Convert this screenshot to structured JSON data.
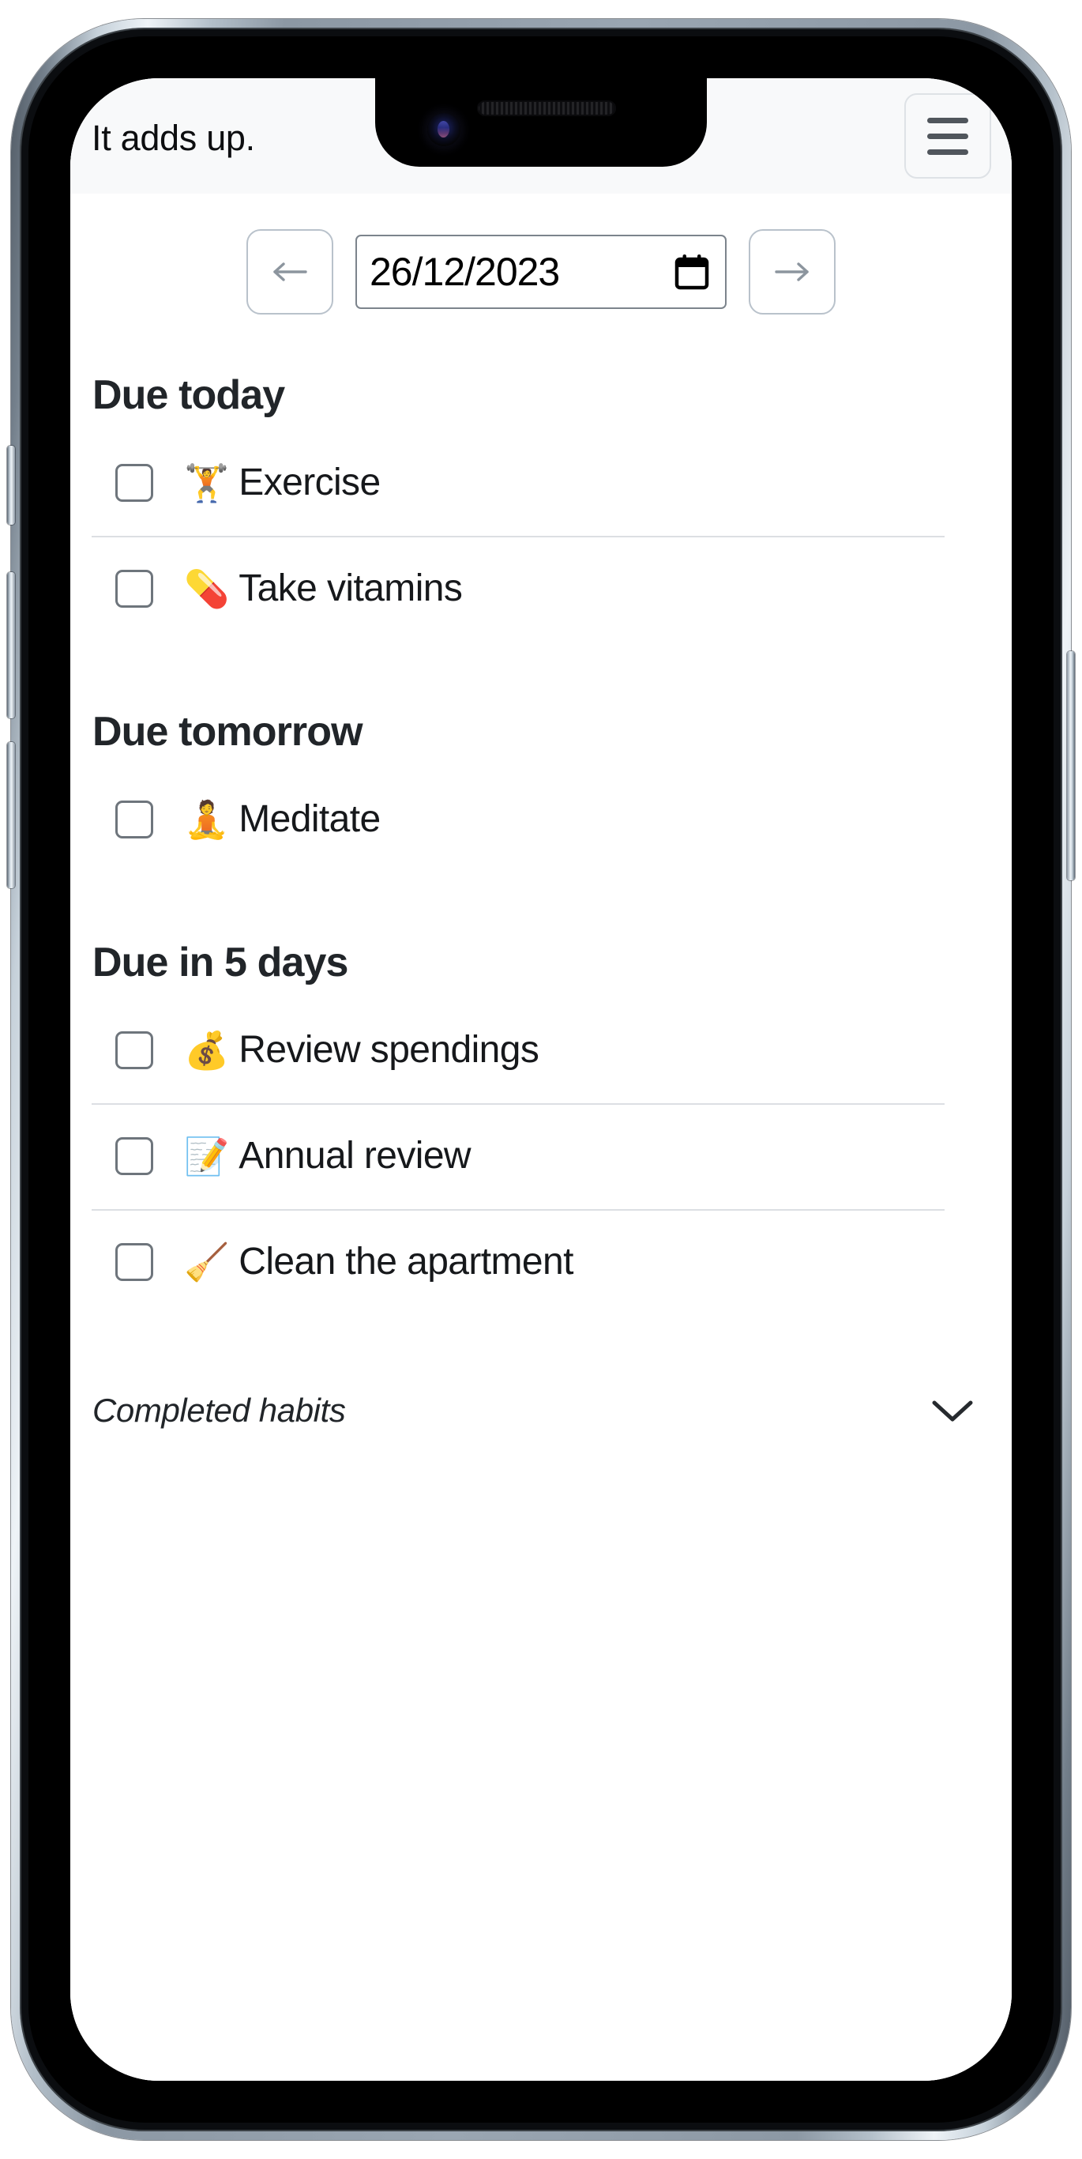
{
  "header": {
    "title": "It adds up.",
    "menu_icon": "hamburger-menu-icon"
  },
  "date_nav": {
    "prev_icon": "arrow-left-icon",
    "next_icon": "arrow-right-icon",
    "calendar_icon": "calendar-icon",
    "date_value": "26/12/2023",
    "date_placeholder": "dd/mm/yyyy"
  },
  "sections": [
    {
      "title": "Due today",
      "habits": [
        {
          "emoji": "🏋️",
          "emoji_name": "weight-lifter-emoji",
          "label": "Exercise",
          "checked": false
        },
        {
          "emoji": "💊",
          "emoji_name": "pill-emoji",
          "label": "Take vitamins",
          "checked": false
        }
      ]
    },
    {
      "title": "Due tomorrow",
      "habits": [
        {
          "emoji": "🧘",
          "emoji_name": "person-in-lotus-position-emoji",
          "label": "Meditate",
          "checked": false
        }
      ]
    },
    {
      "title": "Due in 5 days",
      "habits": [
        {
          "emoji": "💰",
          "emoji_name": "money-bag-emoji",
          "label": "Review spendings",
          "checked": false
        },
        {
          "emoji": "📝",
          "emoji_name": "memo-emoji",
          "label": "Annual review",
          "checked": false
        },
        {
          "emoji": "🧹",
          "emoji_name": "broom-emoji",
          "label": "Clean the apartment",
          "checked": false
        }
      ]
    }
  ],
  "completed": {
    "label": "Completed habits",
    "chevron_icon": "chevron-down-icon",
    "expanded": false
  },
  "colors": {
    "appbar_bg": "#f8f9fa",
    "content_bg": "#ffffff",
    "text_primary": "#212529",
    "border_muted": "#dee2e6",
    "divider": "#dcdfe3",
    "checkbox_border": "#6e757c"
  }
}
